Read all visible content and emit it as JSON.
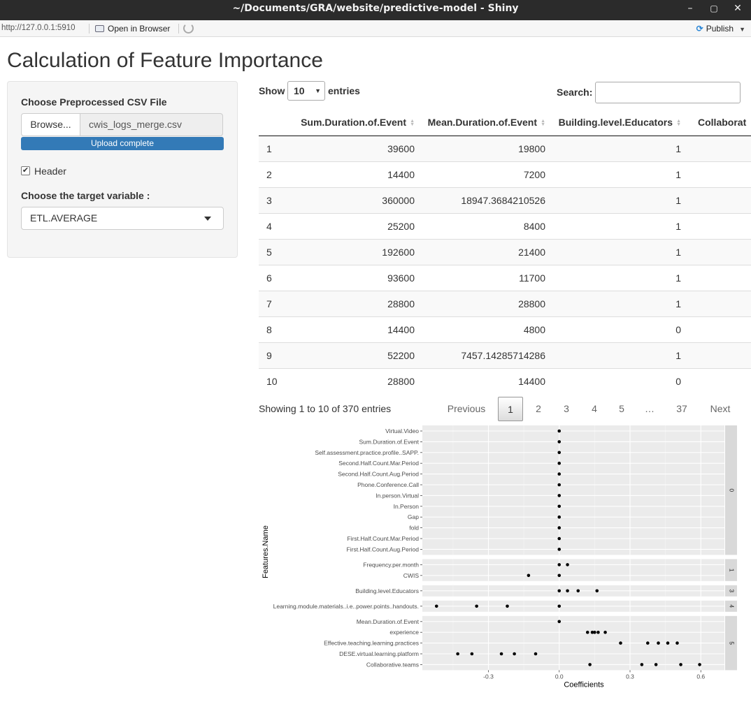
{
  "window": {
    "title": "~/Documents/GRA/website/predictive-model - Shiny",
    "minimize": "–",
    "maximize": "▢",
    "close": "✕"
  },
  "toolbar": {
    "url": "http://127.0.0.1:5910",
    "open_in_browser": "Open in Browser",
    "publish": "Publish"
  },
  "page": {
    "title": "Calculation of Feature Importance"
  },
  "sidebar": {
    "file_label": "Choose Preprocessed CSV File",
    "browse_label": "Browse...",
    "file_name": "cwis_logs_merge.csv",
    "upload_status": "Upload complete",
    "upload_progress_pct": 100,
    "header_checked": true,
    "header_label": "Header",
    "target_label": "Choose the target variable :",
    "target_value": "ETL.AVERAGE"
  },
  "table": {
    "show_label": "Show",
    "page_length": "10",
    "entries_label": "entries",
    "search_label": "Search:",
    "search_value": "",
    "columns": [
      "",
      "Sum.Duration.of.Event",
      "Mean.Duration.of.Event",
      "Building.level.Educators",
      "Collaborat"
    ],
    "rows": [
      [
        "1",
        "39600",
        "19800",
        "1"
      ],
      [
        "2",
        "14400",
        "7200",
        "1"
      ],
      [
        "3",
        "360000",
        "18947.3684210526",
        "1"
      ],
      [
        "4",
        "25200",
        "8400",
        "1"
      ],
      [
        "5",
        "192600",
        "21400",
        "1"
      ],
      [
        "6",
        "93600",
        "11700",
        "1"
      ],
      [
        "7",
        "28800",
        "28800",
        "1"
      ],
      [
        "8",
        "14400",
        "4800",
        "0"
      ],
      [
        "9",
        "52200",
        "7457.14285714286",
        "1"
      ],
      [
        "10",
        "28800",
        "14400",
        "0"
      ]
    ],
    "info": "Showing 1 to 10 of 370 entries",
    "pagination": [
      "Previous",
      "1",
      "2",
      "3",
      "4",
      "5",
      "…",
      "37",
      "Next"
    ],
    "current_page": "1"
  },
  "chart_data": {
    "type": "scatter",
    "xlabel": "Coefficients",
    "ylabel": "Features.Name",
    "xticks": [
      "-0.3",
      "0.0",
      "0.3",
      "0.6"
    ],
    "xlim": [
      -0.58,
      0.7
    ],
    "grid": true,
    "facets": [
      {
        "label": "0",
        "features": [
          "Virtual.Video",
          "Sum.Duration.of.Event",
          "Self.assessment.practice.profile..SAPP.",
          "Second.Half.Count.Mar.Period",
          "Second.Half.Count.Aug.Period",
          "Phone.Conference.Call",
          "In.person.Virtual",
          "In.Person",
          "Gap",
          "fold",
          "First.Half.Count.Mar.Period",
          "First.Half.Count.Aug.Period"
        ],
        "points": [
          {
            "feature": "Virtual.Video",
            "x": [
              0.0
            ]
          },
          {
            "feature": "Sum.Duration.of.Event",
            "x": [
              0.0
            ]
          },
          {
            "feature": "Self.assessment.practice.profile..SAPP.",
            "x": [
              0.0
            ]
          },
          {
            "feature": "Second.Half.Count.Mar.Period",
            "x": [
              0.0
            ]
          },
          {
            "feature": "Second.Half.Count.Aug.Period",
            "x": [
              0.0
            ]
          },
          {
            "feature": "Phone.Conference.Call",
            "x": [
              0.0
            ]
          },
          {
            "feature": "In.person.Virtual",
            "x": [
              0.0
            ]
          },
          {
            "feature": "In.Person",
            "x": [
              0.0
            ]
          },
          {
            "feature": "Gap",
            "x": [
              0.0
            ]
          },
          {
            "feature": "fold",
            "x": [
              0.0
            ]
          },
          {
            "feature": "First.Half.Count.Mar.Period",
            "x": [
              0.0
            ]
          },
          {
            "feature": "First.Half.Count.Aug.Period",
            "x": [
              0.0
            ]
          }
        ]
      },
      {
        "label": "1",
        "features": [
          "Frequency.per.month",
          "CWIS"
        ],
        "points": [
          {
            "feature": "Frequency.per.month",
            "x": [
              0.0,
              0.035
            ]
          },
          {
            "feature": "CWIS",
            "x": [
              -0.13,
              0.0
            ]
          }
        ]
      },
      {
        "label": "3",
        "features": [
          "Building.level.Educators"
        ],
        "points": [
          {
            "feature": "Building.level.Educators",
            "x": [
              0.0,
              0.035,
              0.08,
              0.16
            ]
          }
        ]
      },
      {
        "label": "4",
        "features": [
          "Learning.module.materials..i.e..power.points..handouts."
        ],
        "points": [
          {
            "feature": "Learning.module.materials..i.e..power.points..handouts.",
            "x": [
              -0.52,
              -0.35,
              -0.22,
              0.0
            ]
          }
        ]
      },
      {
        "label": "5",
        "features": [
          "Mean.Duration.of.Event",
          "experience",
          "Effective.teaching.learning.practices",
          "DESE.virtual.learning.platform",
          "Collaborative.teams"
        ],
        "points": [
          {
            "feature": "Mean.Duration.of.Event",
            "x": [
              0.0
            ]
          },
          {
            "feature": "experience",
            "x": [
              0.12,
              0.14,
              0.15,
              0.165,
              0.195
            ]
          },
          {
            "feature": "Effective.teaching.learning.practices",
            "x": [
              0.26,
              0.375,
              0.42,
              0.46,
              0.5
            ]
          },
          {
            "feature": "DESE.virtual.learning.platform",
            "x": [
              -0.43,
              -0.37,
              -0.245,
              -0.19,
              -0.1
            ]
          },
          {
            "feature": "Collaborative.teams",
            "x": [
              0.13,
              0.35,
              0.41,
              0.515,
              0.595
            ]
          }
        ]
      }
    ]
  },
  "colors": {
    "accent": "#337ab7",
    "titlebar": "#2b2b2b",
    "panel_bg": "#ebebeb",
    "strip_bg": "#d9d9d9"
  }
}
